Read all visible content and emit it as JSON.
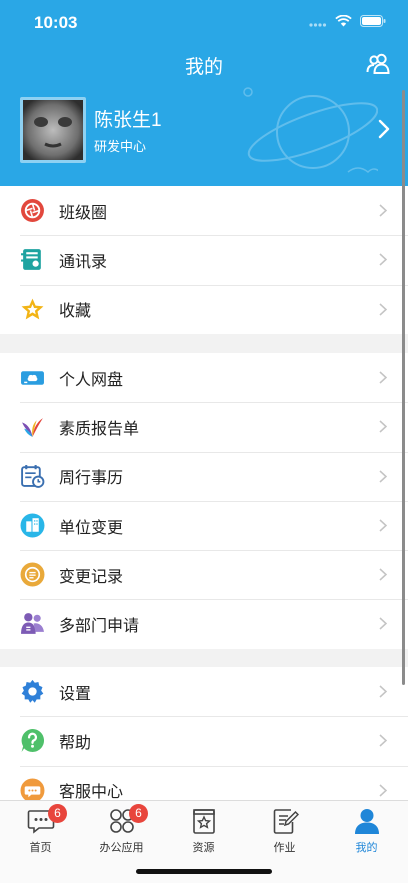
{
  "status": {
    "time": "10:03"
  },
  "nav": {
    "title": "我的",
    "contacts_icon": "contacts-icon"
  },
  "profile": {
    "name": "陈张生1",
    "department": "研发中心"
  },
  "groups": [
    [
      {
        "label": "班级圈",
        "icon": "camera-aperture-icon",
        "color": "#e2483d"
      },
      {
        "label": "通讯录",
        "icon": "address-book-icon",
        "color": "#1ea3a0"
      },
      {
        "label": "收藏",
        "icon": "star-icon",
        "color": "#f2b416"
      }
    ],
    [
      {
        "label": "个人网盘",
        "icon": "cloud-drive-icon",
        "color": "#2a9de0"
      },
      {
        "label": "素质报告单",
        "icon": "quality-report-icon",
        "color": "#e2453c"
      },
      {
        "label": "周行事历",
        "icon": "calendar-clock-icon",
        "color": "#3a6fb0"
      },
      {
        "label": "单位变更",
        "icon": "building-change-icon",
        "color": "#29b6e8"
      },
      {
        "label": "变更记录",
        "icon": "change-record-icon",
        "color": "#e9a93a"
      },
      {
        "label": "多部门申请",
        "icon": "multi-department-icon",
        "color": "#7d5bb5"
      }
    ],
    [
      {
        "label": "设置",
        "icon": "settings-gear-icon",
        "color": "#2f80d8"
      },
      {
        "label": "帮助",
        "icon": "help-icon",
        "color": "#4fc06a"
      },
      {
        "label": "客服中心",
        "icon": "customer-service-icon",
        "color": "#f09a3c"
      }
    ]
  ],
  "tabs": [
    {
      "label": "首页",
      "icon": "chat-bubble-icon",
      "badge": "6"
    },
    {
      "label": "办公应用",
      "icon": "apps-grid-icon",
      "badge": "6"
    },
    {
      "label": "资源",
      "icon": "resource-book-icon",
      "badge": ""
    },
    {
      "label": "作业",
      "icon": "homework-edit-icon",
      "badge": ""
    },
    {
      "label": "我的",
      "icon": "person-icon",
      "badge": "",
      "active": true
    }
  ],
  "colors": {
    "header": "#2aa7e6",
    "active_tab": "#1f86d8",
    "badge": "#e8453c"
  }
}
